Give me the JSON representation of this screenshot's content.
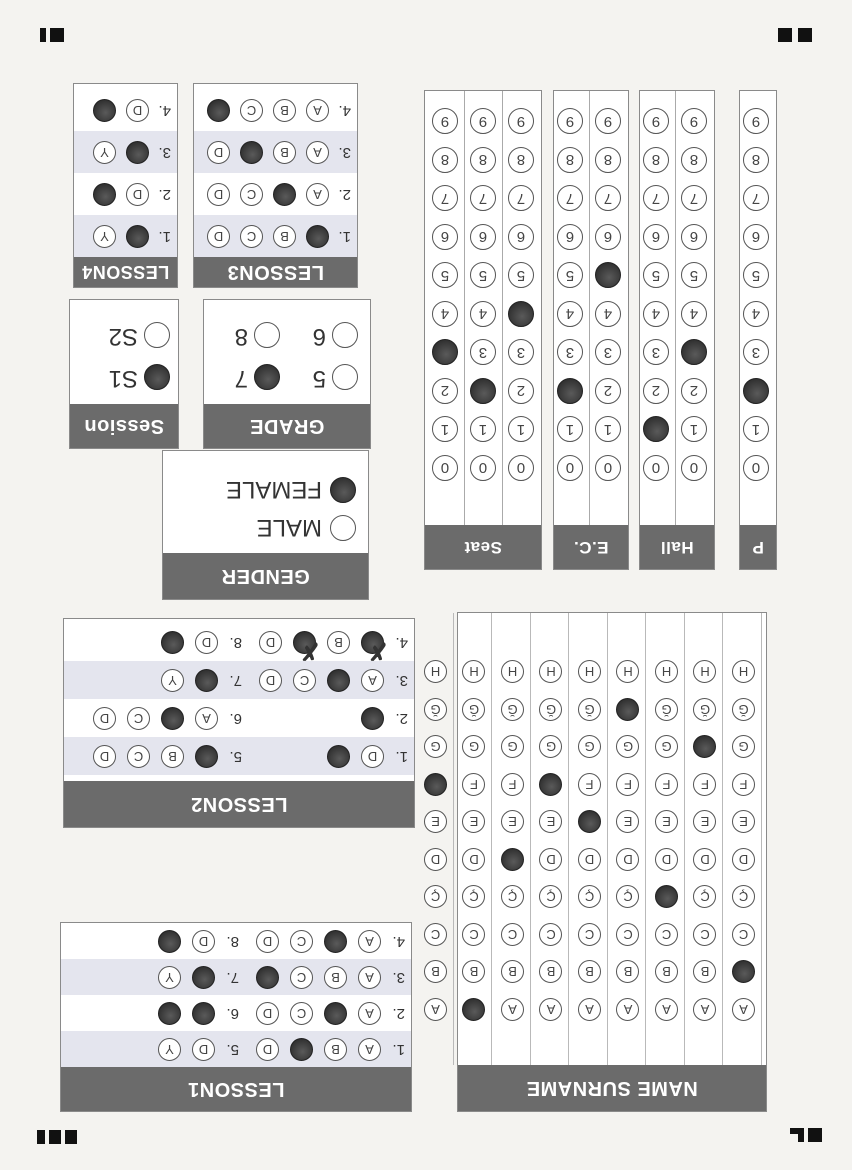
{
  "corner_marks": [
    "corner-mark-top-left",
    "corner-mark-top-right",
    "corner-mark-bottom-left",
    "corner-mark-bottom-right"
  ],
  "name_surname": {
    "header": "NAME SURNAME",
    "letters": [
      "A",
      "B",
      "C",
      "Ç",
      "D",
      "E",
      "F",
      "G",
      "Ğ",
      "H"
    ],
    "filled": [
      "B",
      "G",
      "Ç",
      "Ğ",
      "E",
      "F",
      "D",
      "A",
      "F"
    ]
  },
  "fields": [
    {
      "key": "p",
      "header": "P",
      "filled": [
        2
      ]
    },
    {
      "key": "hall",
      "header": "Hall",
      "filled": [
        3,
        1
      ]
    },
    {
      "key": "ec",
      "header": "E.C.",
      "filled": [
        5,
        2
      ]
    },
    {
      "key": "seat",
      "header": "Seat",
      "filled": [
        4,
        2,
        3
      ]
    }
  ],
  "digits": [
    "0",
    "1",
    "2",
    "3",
    "4",
    "5",
    "6",
    "7",
    "8",
    "9"
  ],
  "gender": {
    "header": "GENDER",
    "options": [
      "MALE",
      "FEMALE"
    ],
    "selected": "FEMALE"
  },
  "grade": {
    "header": "GRADE",
    "options": [
      "5",
      "6",
      "7",
      "8"
    ],
    "selected": "7"
  },
  "session": {
    "header": "Session",
    "options": [
      "S1",
      "S2"
    ],
    "selected": "S1"
  },
  "lesson1": {
    "header": "LESSON1",
    "rows": [
      {
        "label": "1.",
        "options": [
          "A",
          "B",
          "C",
          "D"
        ],
        "filled": [
          "C"
        ],
        "label2": "5.",
        "options2": [
          "D",
          "Y"
        ],
        "filled2": []
      },
      {
        "label": "2.",
        "options": [
          "A",
          "B",
          "C",
          "D"
        ],
        "filled": [
          "B"
        ],
        "label2": "6.",
        "options2": [
          "D",
          "Y"
        ],
        "filled2": [
          "D",
          "Y"
        ]
      },
      {
        "label": "3.",
        "options": [
          "A",
          "B",
          "C",
          "D"
        ],
        "filled": [
          "D"
        ],
        "label2": "7.",
        "options2": [
          "D",
          "Y"
        ],
        "filled2": [
          "D"
        ]
      },
      {
        "label": "4.",
        "options": [
          "A",
          "B",
          "C",
          "D"
        ],
        "filled": [
          "B"
        ],
        "label2": "8.",
        "options2": [
          "D",
          "Y"
        ],
        "filled2": [
          "Y"
        ]
      }
    ]
  },
  "lesson2": {
    "header": "LESSON2",
    "rows": [
      {
        "label": "1.",
        "options": [
          "D",
          "Y"
        ],
        "filled": [
          "Y"
        ],
        "label2": "5.",
        "options2": [
          "A",
          "B",
          "C",
          "D"
        ],
        "filled2": [
          "A"
        ]
      },
      {
        "label": "2.",
        "options": [
          "Y"
        ],
        "filled": [
          "Y"
        ],
        "label2": "6.",
        "options2": [
          "A",
          "B",
          "C",
          "D"
        ],
        "filled2": [
          "B"
        ]
      },
      {
        "label": "3.",
        "options": [
          "A",
          "B",
          "C",
          "D"
        ],
        "filled": [
          "B"
        ],
        "label2": "7.",
        "options2": [
          "D",
          "Y"
        ],
        "filled2": [
          "D"
        ]
      },
      {
        "label": "4.",
        "options": [
          "A",
          "B",
          "C",
          "D"
        ],
        "filled": [
          "A",
          "C"
        ],
        "label2": "8.",
        "options2": [
          "D",
          "Y"
        ],
        "filled2": [
          "Y"
        ]
      }
    ]
  },
  "lesson3": {
    "header": "LESSON3",
    "rows": [
      {
        "label": "1.",
        "options": [
          "A",
          "B",
          "C",
          "D"
        ],
        "filled": [
          "A"
        ]
      },
      {
        "label": "2.",
        "options": [
          "A",
          "B",
          "C",
          "D"
        ],
        "filled": [
          "B"
        ]
      },
      {
        "label": "3.",
        "options": [
          "A",
          "B",
          "C",
          "D"
        ],
        "filled": [
          "C"
        ]
      },
      {
        "label": "4.",
        "options": [
          "A",
          "B",
          "C",
          "D"
        ],
        "filled": [
          "D"
        ]
      }
    ]
  },
  "lesson4": {
    "header": "LESSON4",
    "rows": [
      {
        "label": "1.",
        "options": [
          "D",
          "Y"
        ],
        "filled": [
          "D"
        ]
      },
      {
        "label": "2.",
        "options": [
          "D",
          "Y"
        ],
        "filled": [
          "Y"
        ]
      },
      {
        "label": "3.",
        "options": [
          "D",
          "Y"
        ],
        "filled": [
          "D"
        ]
      },
      {
        "label": "4.",
        "options": [
          "D",
          "Y"
        ],
        "filled": [
          "Y"
        ]
      }
    ]
  },
  "colors": {
    "header_bg": "#6b6b6b",
    "alt_row": "#e4e5ee",
    "ink": "#222222"
  }
}
